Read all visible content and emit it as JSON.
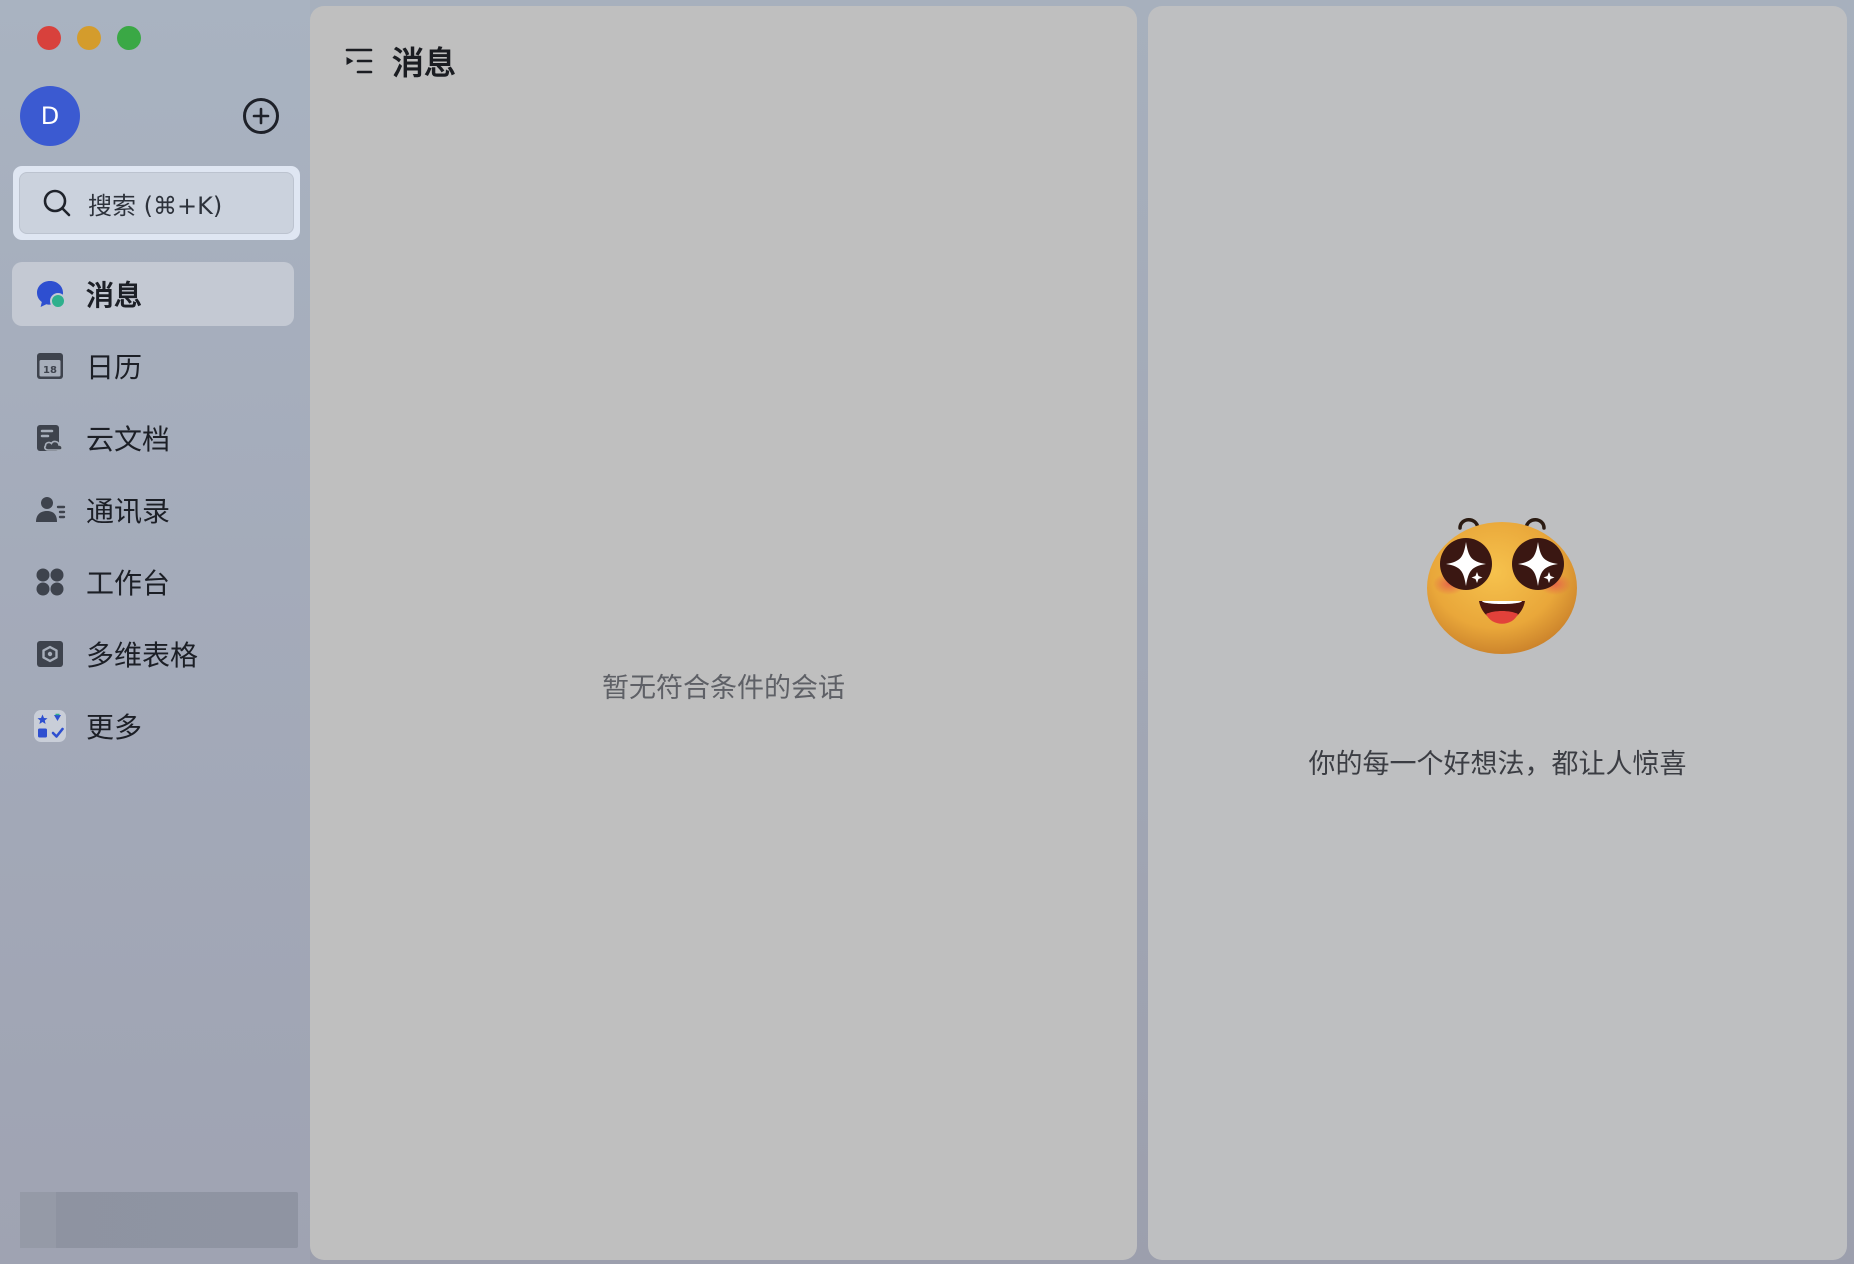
{
  "sidebar": {
    "avatar_initial": "D",
    "search_label": "搜索 (⌘+K)",
    "items": [
      {
        "label": "消息",
        "icon": "chat-icon"
      },
      {
        "label": "日历",
        "icon": "calendar-icon",
        "badge": "18"
      },
      {
        "label": "云文档",
        "icon": "cloud-doc-icon"
      },
      {
        "label": "通讯录",
        "icon": "contacts-icon"
      },
      {
        "label": "工作台",
        "icon": "workspace-icon"
      },
      {
        "label": "多维表格",
        "icon": "base-table-icon"
      },
      {
        "label": "更多",
        "icon": "more-apps-icon"
      }
    ]
  },
  "list_panel": {
    "title": "消息",
    "empty_text": "暂无符合条件的会话"
  },
  "detail_panel": {
    "tagline": "你的每一个好想法，都让人惊喜"
  },
  "colors": {
    "avatar": "#3b5ad1",
    "accent_chat": "#2e4fd0",
    "accent_chat_dot": "#2fb08d",
    "traffic_red": "#d8413c",
    "traffic_yellow": "#d49c2c",
    "traffic_green": "#3aa845"
  }
}
